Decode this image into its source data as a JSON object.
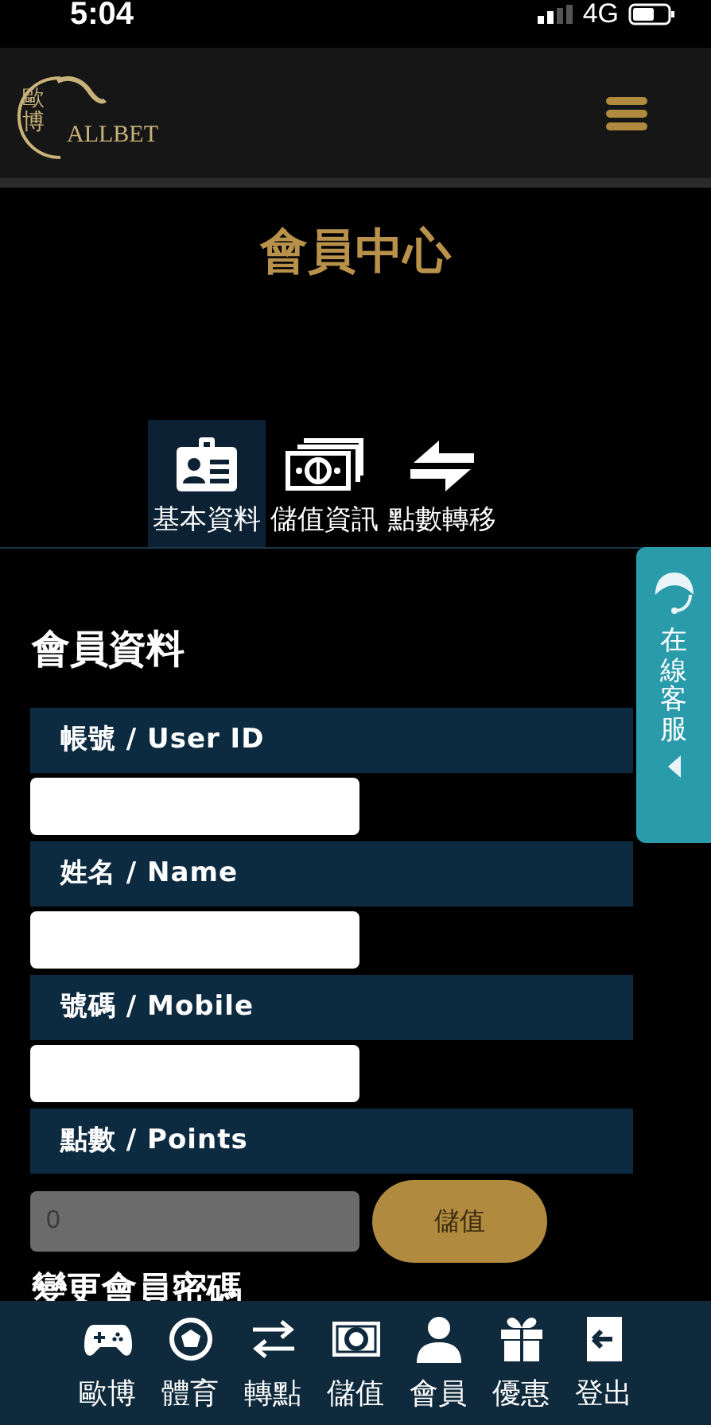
{
  "status_bar": {
    "time": "5:04",
    "network": "4G"
  },
  "header": {
    "logo_cn": "歐博",
    "logo_en": "ALLBET"
  },
  "page_title": "會員中心",
  "tabs": [
    {
      "label": "基本資料",
      "selected": true
    },
    {
      "label": "儲值資訊",
      "selected": false
    },
    {
      "label": "點數轉移",
      "selected": false
    }
  ],
  "section_title": "會員資料",
  "fields": [
    {
      "label": "帳號 / User ID",
      "kind": "masked"
    },
    {
      "label": "姓名 / Name",
      "kind": "masked"
    },
    {
      "label": "號碼 / Mobile",
      "kind": "masked"
    },
    {
      "label": "點數 / Points",
      "kind": "points",
      "value": "0",
      "button": "儲值"
    }
  ],
  "next_section_title": "變更會員密碼",
  "chat_tab": {
    "label": "在線客服"
  },
  "bottom_nav": [
    {
      "label": "歐博"
    },
    {
      "label": "體育"
    },
    {
      "label": "轉點"
    },
    {
      "label": "儲值"
    },
    {
      "label": "會員"
    },
    {
      "label": "優惠"
    },
    {
      "label": "登出"
    }
  ]
}
